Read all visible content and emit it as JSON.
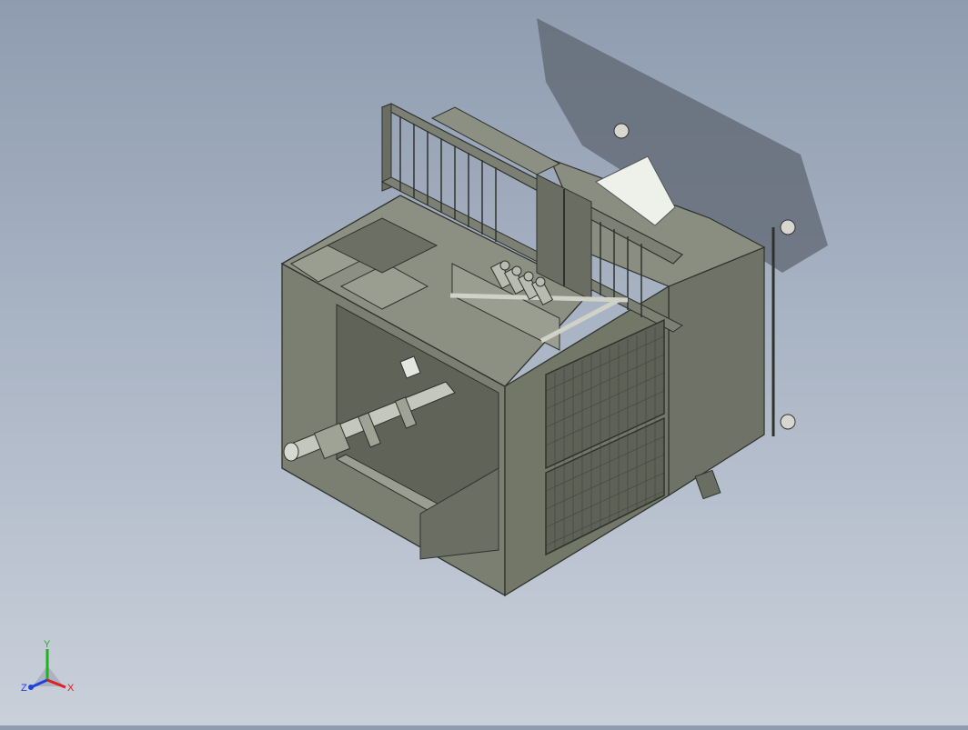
{
  "viewport": {
    "background_top": "#8f9cb0",
    "background_bottom": "#c9d0da",
    "model_color": "#777b6e"
  },
  "triad": {
    "x_label": "X",
    "y_label": "Y",
    "z_label": "Z",
    "x_color": "#e02020",
    "y_color": "#20b020",
    "z_color": "#2040e0"
  }
}
